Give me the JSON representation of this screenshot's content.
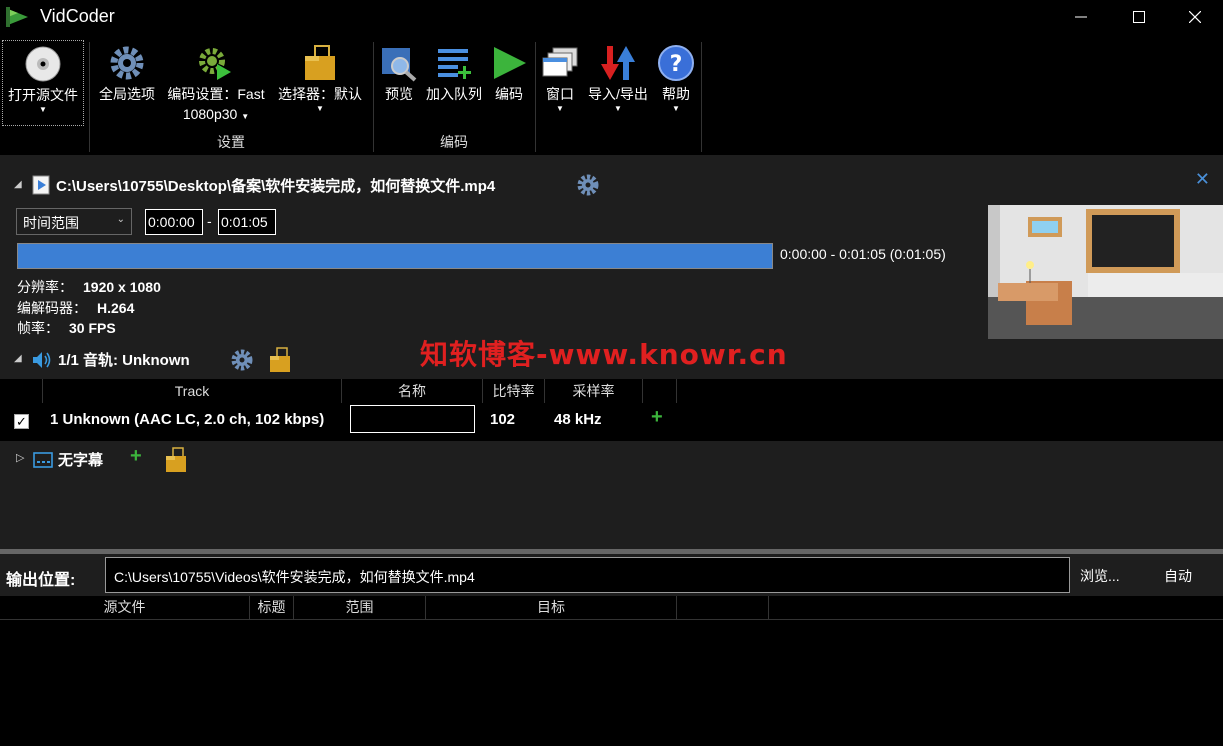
{
  "window": {
    "title": "VidCoder",
    "minimize": "─",
    "maximize": "☐",
    "close": "✕"
  },
  "ribbon": {
    "open_source": "打开源文件",
    "global_options": "全局选项",
    "encoding_settings": "编码设置：Fast",
    "encoding_settings_line2": "1080p30",
    "picker": "选择器：默认",
    "preview": "预览",
    "add_to_queue": "加入队列",
    "encode": "编码",
    "window": "窗口",
    "import_export": "导入/导出",
    "help": "帮助",
    "group_settings": "设置",
    "group_encode": "编码"
  },
  "source": {
    "path": "C:\\Users\\10755\\Desktop\\备案\\软件安装完成，如何替换文件.mp4",
    "range_type": "时间范围",
    "start_time": "0:00:00",
    "end_time": "0:01:05",
    "dash": "-",
    "range_text": "0:00:00 - 0:01:05   (0:01:05)",
    "progress_fraction": 1.0,
    "resolution_label": "分辨率：",
    "resolution": "1920 x 1080",
    "codec_label": "编解码器：",
    "codec": "H.264",
    "framerate_label": "帧率：",
    "framerate": "30 FPS"
  },
  "audio": {
    "title": "1/1 音轨: Unknown",
    "columns": [
      "Track",
      "名称",
      "比特率",
      "采样率"
    ],
    "tracks": [
      {
        "name": "1 Unknown (AAC LC, 2.0 ch, 102 kbps)",
        "title_value": "",
        "bitrate": "102",
        "samplerate": "48 kHz",
        "checked": true
      }
    ]
  },
  "subtitles": {
    "label": "无字幕"
  },
  "watermark": "知软博客-www.knowr.cn",
  "output": {
    "label": "输出位置:",
    "path": "C:\\Users\\10755\\Videos\\软件安装完成，如何替换文件.mp4",
    "browse": "浏览...",
    "auto": "自动"
  },
  "queue": {
    "columns": [
      "源文件",
      "标题",
      "范围",
      "目标"
    ]
  },
  "colors": {
    "accent": "#3c7fd4",
    "watermark": "#e02020",
    "plus": "#3cb43c"
  }
}
